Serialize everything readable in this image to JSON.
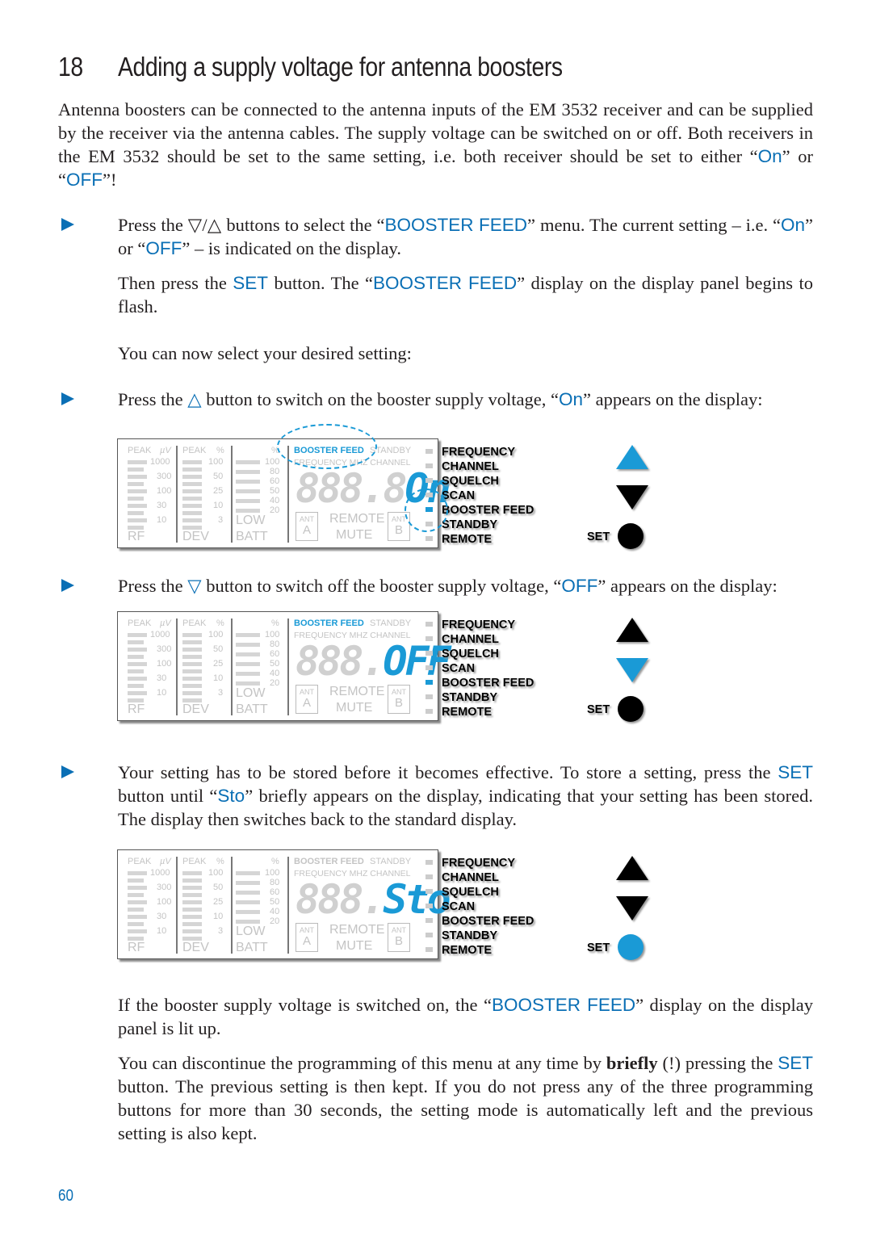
{
  "heading": {
    "number": "18",
    "title": "Adding a supply voltage for antenna boosters"
  },
  "intro": {
    "text": "Antenna boosters can be connected to the antenna inputs of the EM 3532 receiver and can be supplied by the receiver via the antenna cables. The supply voltage can be switched on or off. Both receivers in the EM 3532 should be set to the same setting, i.e. both receiver should be set to either ",
    "on": "On",
    "or": " or ",
    "off": "OFF",
    "end": "!"
  },
  "steps": {
    "s1": {
      "a": "Press the ▽/△ buttons to select the “",
      "hl1": "BOOSTER FEED",
      "b": "” menu. The current setting – i.e. “",
      "hl2": "On",
      "c": "” or “",
      "hl3": "OFF",
      "d": "” – is indicated on the display."
    },
    "s1b": {
      "a": "Then press the ",
      "hl1": "SET",
      "b": " button. The “",
      "hl2": "BOOSTER FEED",
      "c": "” display on the display panel begins to flash."
    },
    "s1c": {
      "a": "You can now select your desired setting:"
    },
    "s2": {
      "a": "Press the ",
      "sym": "△",
      "b": " button to switch on the booster supply voltage, “",
      "hl": "On",
      "c": "” appears on the display:"
    },
    "s3": {
      "a": "Press the ",
      "sym": "▽",
      "b": " button to switch off the booster supply voltage, “",
      "hl": "OFF",
      "c": "” appears on the display:"
    },
    "s4": {
      "a": "Your setting has to be stored before it becomes effective. To store a setting, press the ",
      "hl1": "SET",
      "b": " button until “",
      "hl2": "Sto",
      "c": "” briefly appears on the display, indicating that your setting has been stored. The display then switches back to the standard display."
    },
    "s5": {
      "a": "If the booster supply voltage is switched on, the “",
      "hl": "BOOSTER FEED",
      "b": "” display on the display panel is lit up."
    },
    "s6": {
      "a": "You can discontinue the programming of this menu at any time by ",
      "bold": "briefly",
      "b": " (!) pressing the ",
      "hl": "SET",
      "c": " button. The previous setting is then kept. If you do not press any of the three programming buttons for more than 30 seconds, the setting mode is automatically left and the previous setting is also kept."
    }
  },
  "display_labels": {
    "peak": "PEAK",
    "uv": "µV",
    "pct": "%",
    "rf_scale": [
      "1000",
      "300",
      "100",
      "30",
      "10"
    ],
    "dev_scale": [
      "100",
      "50",
      "25",
      "10",
      "3"
    ],
    "batt_scale": [
      "100",
      "80",
      "60",
      "50",
      "40",
      "20"
    ],
    "rf": "RF",
    "dev": "DEV",
    "low": "LOW",
    "batt": "BATT",
    "booster_feed": "BOOSTER FEED",
    "standby": "STANDBY",
    "freq_line": "FREQUENCY MHZ CHANNEL",
    "ant": "ANT",
    "a": "A",
    "b": "B",
    "remote": "REMOTE",
    "mute": "MUTE",
    "dim_digits": "888.8"
  },
  "menu_items": [
    "FREQUENCY",
    "CHANNEL",
    "SQUELCH",
    "SCAN",
    "BOOSTER FEED",
    "STANDBY",
    "REMOTE"
  ],
  "set_label": "SET",
  "displays": [
    {
      "readout_dim": "888.8",
      "readout_lit": "On",
      "booster_lit": true,
      "active_led": 4,
      "up_active": true,
      "down_active": false,
      "set_active": false
    },
    {
      "readout_dim": "888.",
      "readout_lit": "OFF",
      "booster_lit": true,
      "active_led": 4,
      "up_active": false,
      "down_active": true,
      "set_active": false
    },
    {
      "readout_dim": "888.",
      "readout_lit": "Sto",
      "booster_lit": false,
      "active_led": -1,
      "up_active": false,
      "down_active": false,
      "set_active": true
    }
  ],
  "page_number": "60",
  "colors": {
    "accent": "#0a6fb5",
    "lcd_lit": "#1a9ad6",
    "lcd_dim": "#c4c4c4"
  }
}
